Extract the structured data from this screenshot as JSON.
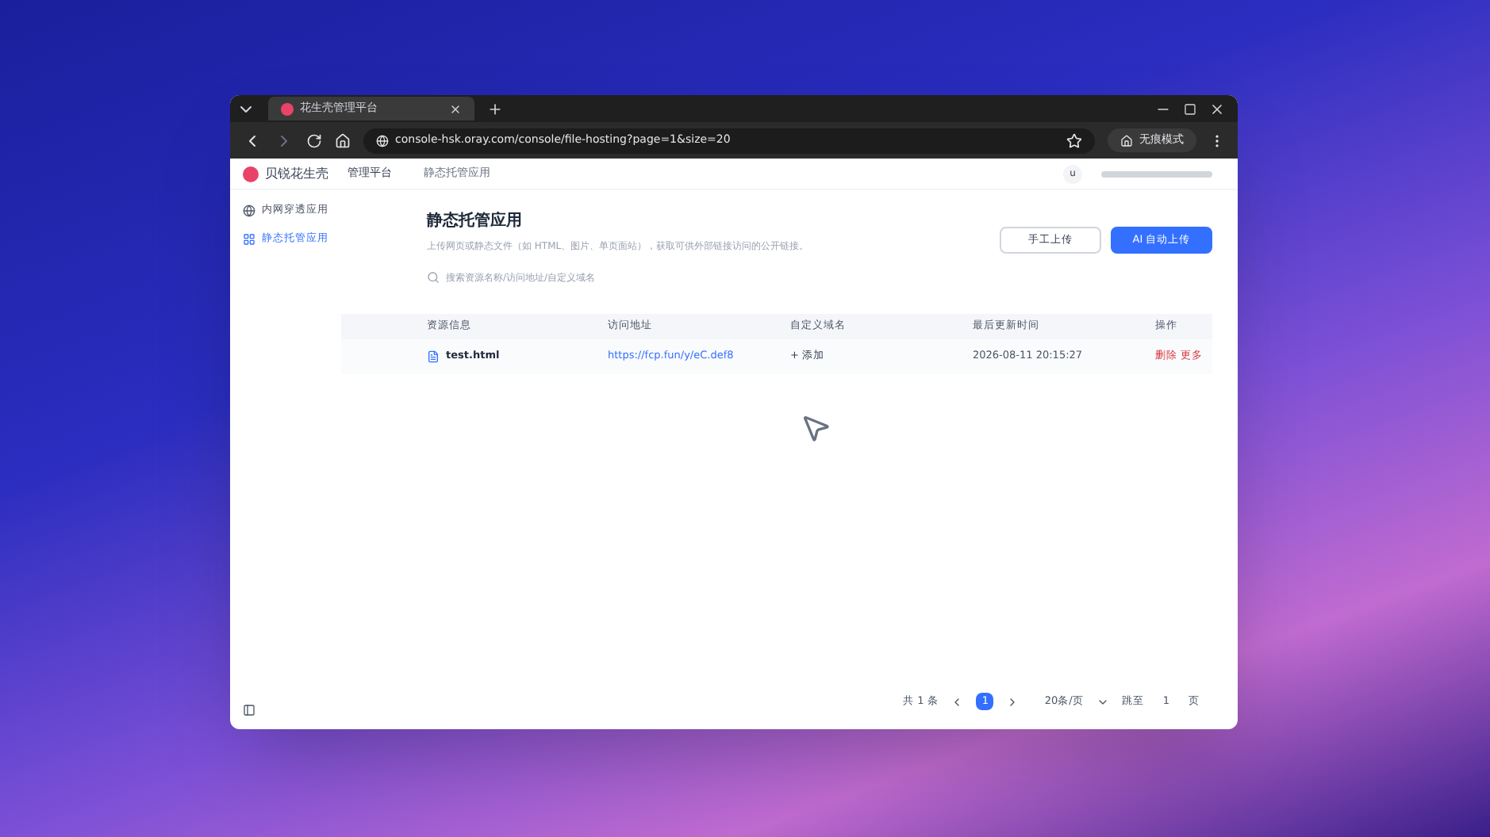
{
  "browser": {
    "tab_title": "花生壳管理平台",
    "url": "console-hsk.oray.com/console/file-hosting?page=1&size=20",
    "profile": "无痕模式"
  },
  "header": {
    "brand": "贝锐花生壳",
    "platform": "管理平台",
    "breadcrumb": "静态托管应用",
    "user": "u"
  },
  "sidebar": {
    "items": [
      {
        "label": "内网穿透应用",
        "selected": false
      },
      {
        "label": "静态托管应用",
        "selected": true
      }
    ]
  },
  "page": {
    "title": "静态托管应用",
    "description": "上传网页或静态文件（如 HTML、图片、单页面站），获取可供外部链接访问的公开链接。",
    "search": {
      "placeholder": "搜索资源名称/访问地址/自定义域名"
    },
    "buttons": [
      {
        "label": "手工上传",
        "kind": "secondary"
      },
      {
        "label": "AI 自动上传",
        "kind": "primary"
      }
    ]
  },
  "table": {
    "columns": [
      "资源信息",
      "访问地址",
      "自定义域名",
      "最后更新时间",
      "操作"
    ],
    "rows": [
      {
        "name": "test.html",
        "url": "https://fcp.fun/y/eC.def8",
        "domain": "+ 添加",
        "updated": "2026-08-11 20:15:27",
        "action": "删除 更多"
      }
    ]
  },
  "pagination": {
    "total": "共 1 条",
    "pages": [
      {
        "label": "1",
        "selected": true
      }
    ],
    "page_size": "20条/页",
    "jump_label": "跳至",
    "jump_value": "1",
    "page_suffix": "页"
  }
}
